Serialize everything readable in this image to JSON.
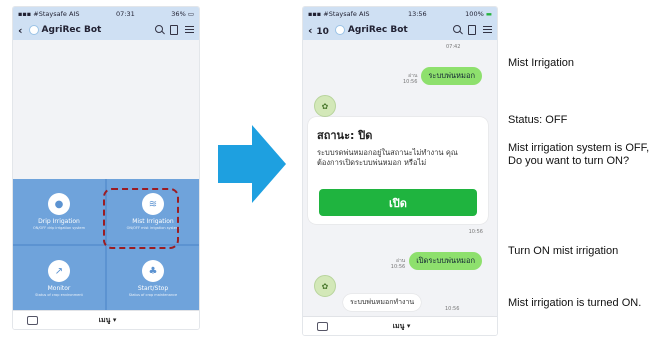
{
  "phone1": {
    "status": {
      "carrier": "#Staysafe AIS",
      "time": "07:31",
      "battery": "36%"
    },
    "header": {
      "title": "AgriRec Bot"
    },
    "tiles": [
      {
        "name": "Drip Irrigation",
        "sub": "ON/OFF drip irrigation system"
      },
      {
        "name": "Mist Irrigation",
        "sub": "ON/OFF mist irrigation system"
      },
      {
        "name": "Monitor",
        "sub": "Status of crop environment"
      },
      {
        "name": "Start/Stop",
        "sub": "Status of crop maintenance"
      }
    ],
    "footer": {
      "menu": "เมนู ▾"
    }
  },
  "phone2": {
    "status": {
      "carrier": "#Staysafe AIS",
      "time": "13:56",
      "battery": "100%"
    },
    "header": {
      "back_count": "10",
      "title": "AgriRec Bot"
    },
    "top_time": "07:42",
    "msg1": {
      "read": "อ่าน",
      "time": "10:56",
      "text": "ระบบพ่นหมอก"
    },
    "card": {
      "title": "สถานะ: ปิด",
      "body": "ระบบรดพ่นหมอกอยู่ในสถานะไม่ทำงาน คุณต้องการเปิดระบบพ่นหมอก หรือไม่",
      "button": "เปิด",
      "time": "10:56"
    },
    "msg2": {
      "read": "อ่าน",
      "time": "10:56",
      "text": "เปิดระบบพ่นหมอก"
    },
    "reply": {
      "text": "ระบบพ่นหมอกทำงาน",
      "time": "10:56"
    },
    "footer": {
      "menu": "เมนู ▾"
    }
  },
  "captions": {
    "c1": "Mist Irrigation",
    "c2": "Status: OFF",
    "c3": "Mist irrigation system is OFF, Do you want to turn ON?",
    "c4": "Turn ON mist irrigation",
    "c5": "Mist irrigation is turned ON."
  },
  "colors": {
    "accent": "#1fb43f",
    "header": "#cfe0f3",
    "tiles": "#6fa3db",
    "highlight": "#9b1c22",
    "arrow": "#1ea0e0"
  }
}
